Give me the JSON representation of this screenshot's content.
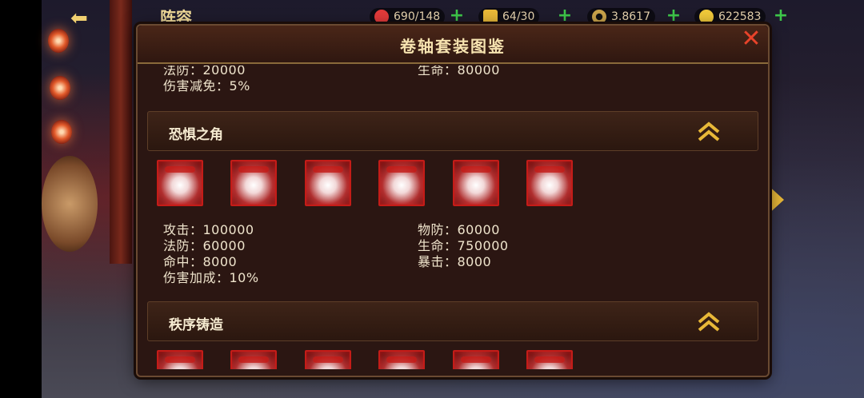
{
  "topbar": {
    "title": "阵容",
    "stamina": "690/148",
    "energy": "64/30",
    "coins": "3.8617",
    "gold": "622583"
  },
  "panel": {
    "title": "卷轴套装图鉴"
  },
  "prev_section": {
    "stats_left": [
      "法防：20000",
      "伤害减免：5%"
    ],
    "stats_right": [
      "生命：80000"
    ]
  },
  "sections": [
    {
      "name": "恐惧之角",
      "stats_left": [
        "攻击：100000",
        "法防：60000",
        "命中：8000",
        "伤害加成：10%"
      ],
      "stats_right": [
        "物防：60000",
        "生命：750000",
        "暴击：8000"
      ]
    },
    {
      "name": "秩序铸造"
    }
  ],
  "colors": {
    "accent": "#e8b838",
    "plus": "#3ec84a",
    "close": "#e8432a",
    "scroll_frame": "#c41c18"
  }
}
